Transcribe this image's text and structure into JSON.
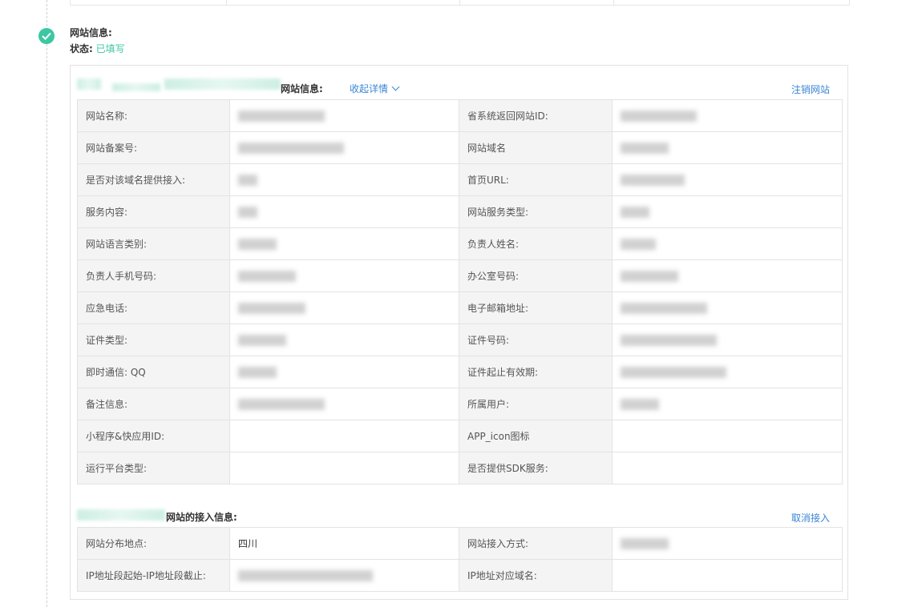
{
  "step": {
    "title": "网站信息:",
    "status_label": "状态:",
    "status_value": "已填写",
    "icon": "check-icon",
    "accent": "#3cc7a2"
  },
  "site_section": {
    "title": "网站信息:",
    "toggle_label": "收起详情",
    "action_label": "注销网站",
    "rows": [
      [
        "网站名称:",
        "",
        "省系统返回网站ID:",
        ""
      ],
      [
        "网站备案号:",
        "",
        "网站域名",
        ""
      ],
      [
        "是否对该域名提供接入:",
        "",
        "首页URL:",
        ""
      ],
      [
        "服务内容:",
        "",
        "网站服务类型:",
        ""
      ],
      [
        "网站语言类别:",
        "",
        "负责人姓名:",
        ""
      ],
      [
        "负责人手机号码:",
        "",
        "办公室号码:",
        ""
      ],
      [
        "应急电话:",
        "",
        "电子邮箱地址:",
        ""
      ],
      [
        "证件类型:",
        "",
        "证件号码:",
        ""
      ],
      [
        "即时通信: QQ",
        "",
        "证件起止有效期:",
        ""
      ],
      [
        "备注信息:",
        "",
        "所属用户:",
        ""
      ],
      [
        "小程序&快应用ID:",
        "",
        "APP_icon图标",
        ""
      ],
      [
        "运行平台类型:",
        "",
        "是否提供SDK服务:",
        ""
      ]
    ]
  },
  "access_section": {
    "title": "网站的接入信息:",
    "action_label": "取消接入",
    "rows": [
      [
        "网站分布地点:",
        "四川",
        "网站接入方式:",
        ""
      ],
      [
        "IP地址段起始-IP地址段截止:",
        "",
        "IP地址对应域名:",
        ""
      ]
    ]
  },
  "link_color": "#3a86d6"
}
